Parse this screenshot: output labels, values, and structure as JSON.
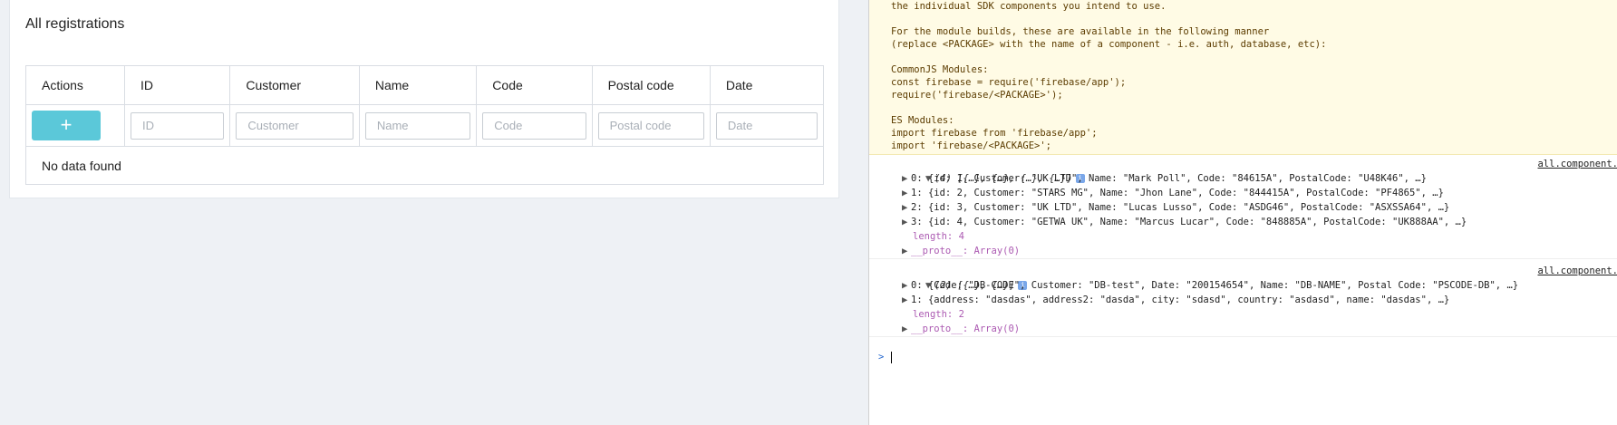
{
  "app": {
    "card_title": "All registrations",
    "columns": [
      "Actions",
      "ID",
      "Customer",
      "Name",
      "Code",
      "Postal code",
      "Date"
    ],
    "add_button_label": "+",
    "filters": [
      {
        "placeholder": "ID",
        "value": ""
      },
      {
        "placeholder": "Customer",
        "value": ""
      },
      {
        "placeholder": "Name",
        "value": ""
      },
      {
        "placeholder": "Code",
        "value": ""
      },
      {
        "placeholder": "Postal code",
        "value": ""
      },
      {
        "placeholder": "Date",
        "value": ""
      }
    ],
    "empty_message": "No data found"
  },
  "console": {
    "warning_lines": [
      "the individual SDK components you intend to use.",
      "",
      "For the module builds, these are available in the following manner",
      "(replace <PACKAGE> with the name of a component - i.e. auth, database, etc):",
      "",
      "CommonJS Modules:",
      "const firebase = require('firebase/app');",
      "require('firebase/<PACKAGE>');",
      "",
      "ES Modules:",
      "import firebase from 'firebase/app';",
      "import 'firebase/<PACKAGE>';"
    ],
    "logs": [
      {
        "source": "all.component.",
        "header": "(4) [{…}, {…}, {…}, {…}]",
        "rows": [
          "0: {id: 1, Customer: \"UK LTD\", Name: \"Mark Poll\", Code: \"84615A\", PostalCode: \"U48K46\", …}",
          "1: {id: 2, Customer: \"STARS MG\", Name: \"Jhon Lane\", Code: \"844415A\", PostalCode: \"PF4865\", …}",
          "2: {id: 3, Customer: \"UK LTD\", Name: \"Lucas Lusso\", Code: \"ASDG46\", PostalCode: \"ASXSSA64\", …}",
          "3: {id: 4, Customer: \"GETWA UK\", Name: \"Marcus Lucar\", Code: \"848885A\", PostalCode: \"UK888AA\", …}"
        ],
        "length_label": "length: 4",
        "proto_label": "__proto__: Array(0)"
      },
      {
        "source": "all.component.",
        "header": "(2) [{…}, {…}]",
        "rows": [
          "0: {Code: \"DB-CODE\", Customer: \"DB-test\", Date: \"200154654\", Name: \"DB-NAME\", Postal Code: \"PSCODE-DB\", …}",
          "1: {address: \"dasdas\", address2: \"dasda\", city: \"sdasd\", country: \"asdasd\", name: \"dasdas\", …}"
        ],
        "length_label": "length: 2",
        "proto_label": "__proto__: Array(0)"
      }
    ],
    "prompt_symbol": ">"
  },
  "colors": {
    "add_button": "#5bc8d9",
    "warning_bg": "#fffbe5",
    "string_value": "#c41a16",
    "number_value": "#1c00cf",
    "key": "#881391"
  }
}
